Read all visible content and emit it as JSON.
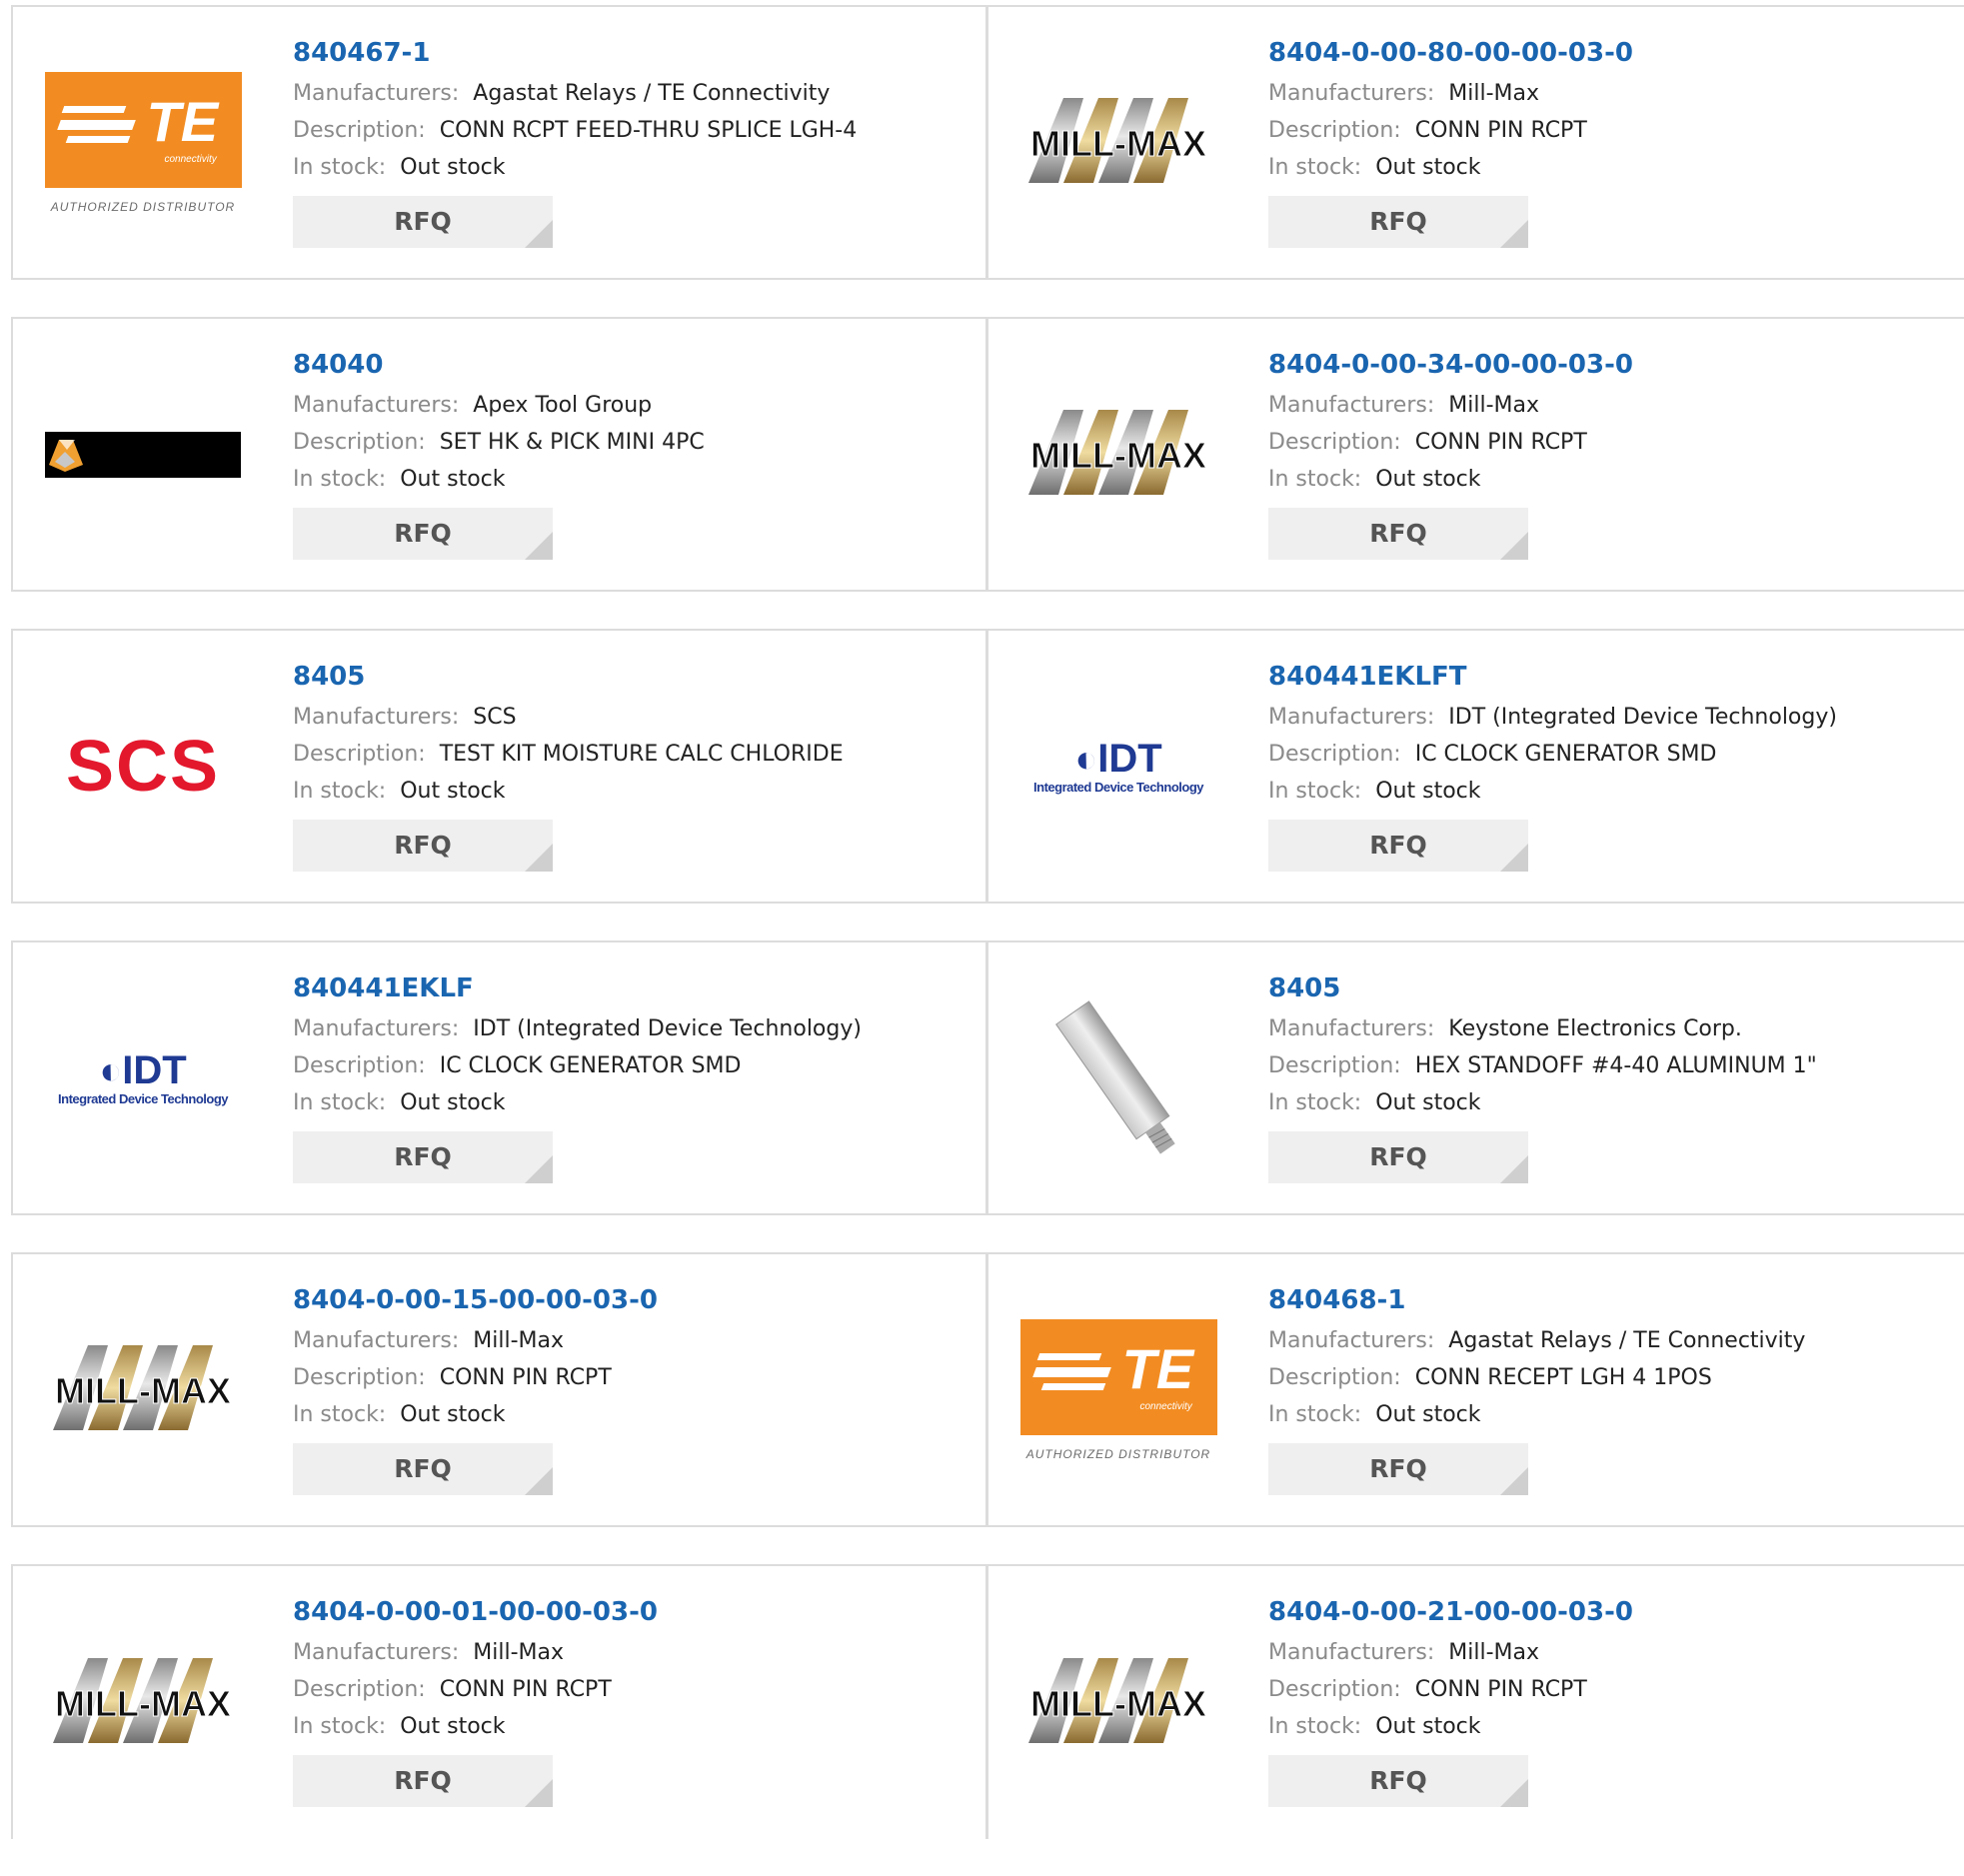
{
  "labels": {
    "manufacturers": "Manufacturers:",
    "description": "Description:",
    "stock": "In stock:",
    "rfq": "RFQ"
  },
  "logos": {
    "te": {
      "mark": "TE",
      "sub": "connectivity",
      "tagline": "AUTHORIZED DISTRIBUTOR"
    },
    "scs": {
      "mark": "SCS"
    },
    "idt": {
      "mark": "IDT",
      "sub": "Integrated Device Technology"
    },
    "millmax": {
      "mark": "MILL-MAX"
    }
  },
  "colors": {
    "part_link": "#1a65b0",
    "te_orange": "#f28c22",
    "scs_red": "#e3182d",
    "idt_blue": "#1f3a93"
  },
  "products": [
    {
      "part": "840467-1",
      "manufacturer": "Agastat Relays / TE Connectivity",
      "description": "CONN RCPT FEED-THRU SPLICE LGH-4",
      "stock": "Out stock",
      "logo": "te"
    },
    {
      "part": "8404-0-00-80-00-00-03-0",
      "manufacturer": "Mill-Max",
      "description": "CONN PIN RCPT",
      "stock": "Out stock",
      "logo": "millmax"
    },
    {
      "part": "84040",
      "manufacturer": "Apex Tool Group",
      "description": "SET HK & PICK MINI 4PC",
      "stock": "Out stock",
      "logo": "apex"
    },
    {
      "part": "8404-0-00-34-00-00-03-0",
      "manufacturer": "Mill-Max",
      "description": "CONN PIN RCPT",
      "stock": "Out stock",
      "logo": "millmax"
    },
    {
      "part": "8405",
      "manufacturer": "SCS",
      "description": "TEST KIT MOISTURE CALC CHLORIDE",
      "stock": "Out stock",
      "logo": "scs"
    },
    {
      "part": "840441EKLFT",
      "manufacturer": "IDT (Integrated Device Technology)",
      "description": "IC CLOCK GENERATOR SMD",
      "stock": "Out stock",
      "logo": "idt"
    },
    {
      "part": "840441EKLF",
      "manufacturer": "IDT (Integrated Device Technology)",
      "description": "IC CLOCK GENERATOR SMD",
      "stock": "Out stock",
      "logo": "idt"
    },
    {
      "part": "8405",
      "manufacturer": "Keystone Electronics Corp.",
      "description": "HEX STANDOFF #4-40 ALUMINUM 1\"",
      "stock": "Out stock",
      "logo": "standoff"
    },
    {
      "part": "8404-0-00-15-00-00-03-0",
      "manufacturer": "Mill-Max",
      "description": "CONN PIN RCPT",
      "stock": "Out stock",
      "logo": "millmax"
    },
    {
      "part": "840468-1",
      "manufacturer": "Agastat Relays / TE Connectivity",
      "description": "CONN RECEPT LGH 4 1POS",
      "stock": "Out stock",
      "logo": "te"
    },
    {
      "part": "8404-0-00-01-00-00-03-0",
      "manufacturer": "Mill-Max",
      "description": "CONN PIN RCPT",
      "stock": "Out stock",
      "logo": "millmax"
    },
    {
      "part": "8404-0-00-21-00-00-03-0",
      "manufacturer": "Mill-Max",
      "description": "CONN PIN RCPT",
      "stock": "Out stock",
      "logo": "millmax"
    }
  ]
}
